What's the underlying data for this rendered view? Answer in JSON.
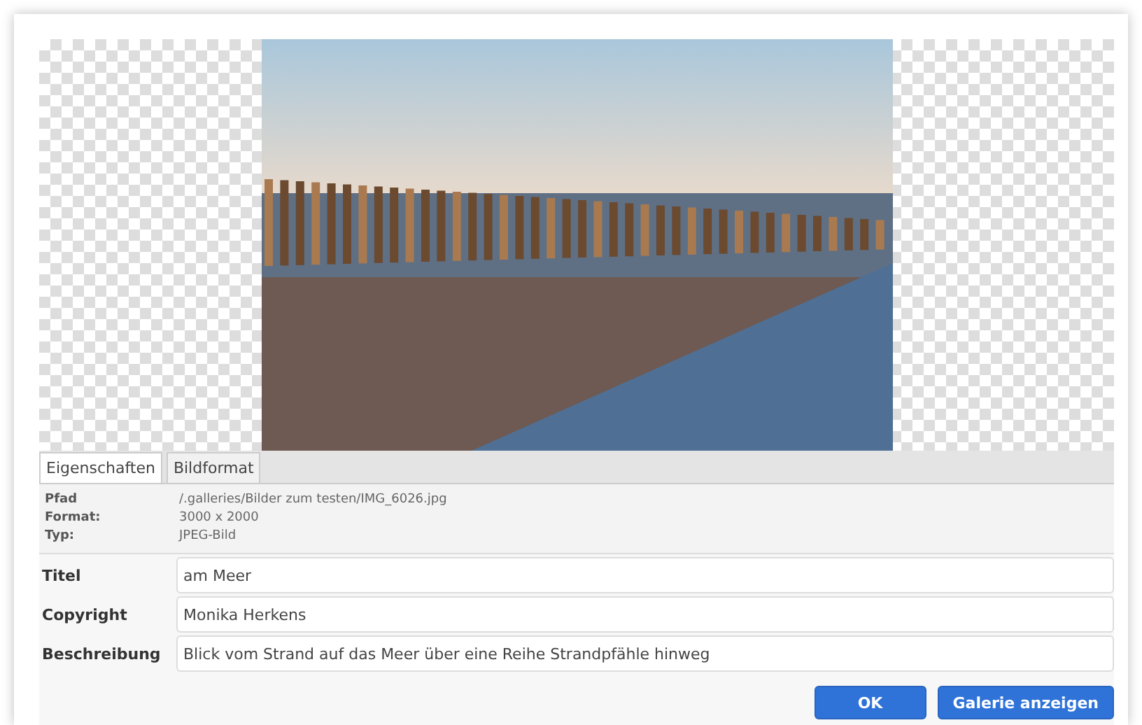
{
  "tabs": [
    {
      "label": "Eigenschaften",
      "selected": true
    },
    {
      "label": "Bildformat",
      "selected": false
    }
  ],
  "info": [
    {
      "label": "Pfad",
      "value": "/.galleries/Bilder zum testen/IMG_6026.jpg"
    },
    {
      "label": "Format:",
      "value": "3000 x 2000"
    },
    {
      "label": "Typ:",
      "value": "JPEG-Bild"
    }
  ],
  "fields": [
    {
      "label": "Titel",
      "value": "am Meer"
    },
    {
      "label": "Copyright",
      "value": "Monika Herkens"
    },
    {
      "label": "Beschreibung",
      "value": "Blick vom Strand auf das Meer über eine Reihe Strandpfähle hinweg"
    }
  ],
  "buttons": [
    "OK",
    "Galerie anzeigen"
  ]
}
